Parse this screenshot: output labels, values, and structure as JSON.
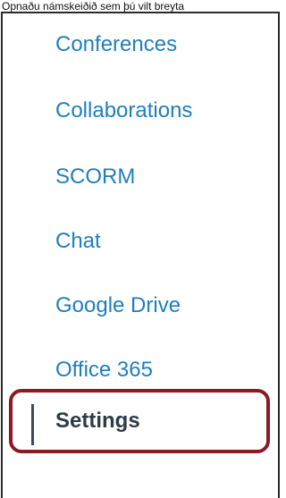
{
  "caption": "Opnaðu námskeiðið sem þú vilt breyta",
  "nav": {
    "items": [
      {
        "label": "Conferences"
      },
      {
        "label": "Collaborations"
      },
      {
        "label": "SCORM"
      },
      {
        "label": "Chat"
      },
      {
        "label": "Google Drive"
      },
      {
        "label": "Office 365"
      }
    ],
    "active_item": {
      "label": "Settings"
    }
  },
  "colors": {
    "link": "#1f7fbd",
    "active_text": "#2d3b45",
    "highlight_border": "#8b1a24",
    "active_indicator": "#3f4a55"
  }
}
